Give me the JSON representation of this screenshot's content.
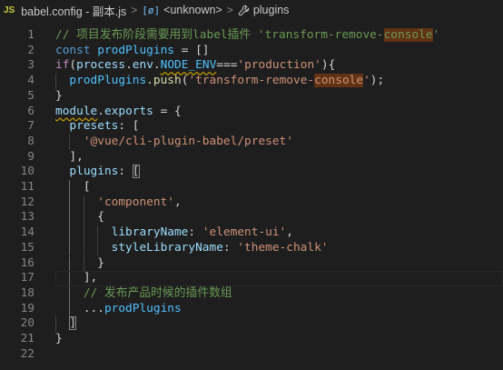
{
  "breadcrumb": {
    "file_badge": "JS",
    "file": "babel.config - 副本.js",
    "sep": ">",
    "symbol1": "<unknown>",
    "symbol2": "plugins"
  },
  "editor": {
    "lines": [
      {
        "n": "1",
        "tokens": [
          {
            "t": "// 项目发布阶段需要用到label插件 'transform-remove-",
            "c": "c"
          },
          {
            "t": "console",
            "c": "c hl"
          },
          {
            "t": "'",
            "c": "c"
          }
        ]
      },
      {
        "n": "2",
        "tokens": [
          {
            "t": "const ",
            "c": "k"
          },
          {
            "t": "prodPlugins",
            "c": "cst"
          },
          {
            "t": " = []",
            "c": "p"
          }
        ]
      },
      {
        "n": "3",
        "tokens": [
          {
            "t": "if",
            "c": "f"
          },
          {
            "t": "(",
            "c": "p"
          },
          {
            "t": "process",
            "c": "v"
          },
          {
            "t": ".",
            "c": "p"
          },
          {
            "t": "env",
            "c": "v"
          },
          {
            "t": ".",
            "c": "p"
          },
          {
            "t": "NODE_ENV",
            "c": "cst sq"
          },
          {
            "t": "===",
            "c": "p"
          },
          {
            "t": "'production'",
            "c": "s"
          },
          {
            "t": "){",
            "c": "p"
          }
        ]
      },
      {
        "n": "4",
        "tokens": [
          {
            "t": "  ",
            "c": "p"
          },
          {
            "t": "prodPlugins",
            "c": "cst"
          },
          {
            "t": ".",
            "c": "p"
          },
          {
            "t": "push",
            "c": "fn"
          },
          {
            "t": "(",
            "c": "p"
          },
          {
            "t": "'transform-remove-",
            "c": "s"
          },
          {
            "t": "console",
            "c": "s hl"
          },
          {
            "t": "'",
            "c": "s"
          },
          {
            "t": ");",
            "c": "p"
          }
        ]
      },
      {
        "n": "5",
        "tokens": [
          {
            "t": "}",
            "c": "p"
          }
        ]
      },
      {
        "n": "6",
        "tokens": [
          {
            "t": "module",
            "c": "v sq"
          },
          {
            "t": ".",
            "c": "p"
          },
          {
            "t": "exports",
            "c": "v"
          },
          {
            "t": " = {",
            "c": "p"
          }
        ]
      },
      {
        "n": "7",
        "tokens": [
          {
            "t": "  ",
            "c": "p"
          },
          {
            "t": "presets",
            "c": "v"
          },
          {
            "t": ": [",
            "c": "p"
          }
        ]
      },
      {
        "n": "8",
        "tokens": [
          {
            "t": "    ",
            "c": "p"
          },
          {
            "t": "'@vue/cli-plugin-babel/preset'",
            "c": "s"
          }
        ]
      },
      {
        "n": "9",
        "tokens": [
          {
            "t": "  ],",
            "c": "p"
          }
        ]
      },
      {
        "n": "10",
        "tokens": [
          {
            "t": "  ",
            "c": "p"
          },
          {
            "t": "plugins",
            "c": "v"
          },
          {
            "t": ": ",
            "c": "p"
          },
          {
            "t": "[",
            "c": "p bm"
          }
        ]
      },
      {
        "n": "11",
        "tokens": [
          {
            "t": "    [",
            "c": "p"
          }
        ]
      },
      {
        "n": "12",
        "tokens": [
          {
            "t": "      ",
            "c": "p"
          },
          {
            "t": "'component'",
            "c": "s"
          },
          {
            "t": ",",
            "c": "p"
          }
        ]
      },
      {
        "n": "13",
        "tokens": [
          {
            "t": "      {",
            "c": "p"
          }
        ]
      },
      {
        "n": "14",
        "tokens": [
          {
            "t": "        ",
            "c": "p"
          },
          {
            "t": "libraryName",
            "c": "v"
          },
          {
            "t": ": ",
            "c": "p"
          },
          {
            "t": "'element-ui'",
            "c": "s"
          },
          {
            "t": ",",
            "c": "p"
          }
        ]
      },
      {
        "n": "15",
        "tokens": [
          {
            "t": "        ",
            "c": "p"
          },
          {
            "t": "styleLibraryName",
            "c": "v"
          },
          {
            "t": ": ",
            "c": "p"
          },
          {
            "t": "'theme-chalk'",
            "c": "s"
          }
        ]
      },
      {
        "n": "16",
        "tokens": [
          {
            "t": "      }",
            "c": "p"
          }
        ]
      },
      {
        "n": "17",
        "tokens": [
          {
            "t": "    ],",
            "c": "p"
          }
        ]
      },
      {
        "n": "18",
        "tokens": [
          {
            "t": "    ",
            "c": "p"
          },
          {
            "t": "// 发布产品时候的插件数组",
            "c": "c"
          }
        ]
      },
      {
        "n": "19",
        "tokens": [
          {
            "t": "    ...",
            "c": "p"
          },
          {
            "t": "prodPlugins",
            "c": "cst"
          }
        ]
      },
      {
        "n": "20",
        "tokens": [
          {
            "t": "  ",
            "c": "p"
          },
          {
            "t": "]",
            "c": "p bm"
          }
        ]
      },
      {
        "n": "21",
        "tokens": [
          {
            "t": "}",
            "c": "p"
          }
        ]
      },
      {
        "n": "22",
        "tokens": []
      }
    ]
  }
}
